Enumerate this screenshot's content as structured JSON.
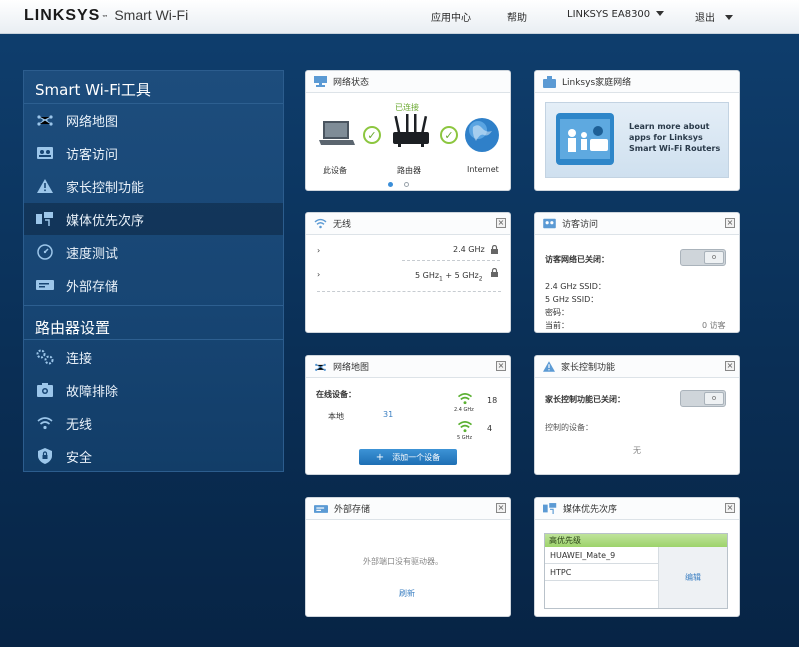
{
  "header": {
    "brand": "LINKSYS",
    "tm": "™",
    "subtitle": "Smart Wi-Fi",
    "nav": [
      "应用中心",
      "帮助",
      "LINKSYS EA8300",
      "退出"
    ]
  },
  "sidebar": {
    "tools_title": "Smart Wi-Fi工具",
    "tools": [
      {
        "label": "网络地图",
        "icon": "network-map-icon"
      },
      {
        "label": "访客访问",
        "icon": "guest-access-icon"
      },
      {
        "label": "家长控制功能",
        "icon": "parental-controls-icon"
      },
      {
        "label": "媒体优先次序",
        "icon": "media-prioritization-icon"
      },
      {
        "label": "速度测试",
        "icon": "speed-test-icon"
      },
      {
        "label": "外部存储",
        "icon": "external-storage-icon"
      }
    ],
    "router_title": "路由器设置",
    "router": [
      {
        "label": "连接",
        "icon": "connectivity-icon"
      },
      {
        "label": "故障排除",
        "icon": "troubleshooting-icon"
      },
      {
        "label": "无线",
        "icon": "wireless-icon"
      },
      {
        "label": "安全",
        "icon": "security-icon"
      }
    ]
  },
  "network_status": {
    "title": "网络状态",
    "connected": "已连接",
    "this_device": "此设备",
    "router": "路由器",
    "internet": "Internet"
  },
  "linksys_home": {
    "title": "Linksys家庭网络",
    "promo": "Learn more about apps for Linksys Smart Wi-Fi Routers"
  },
  "wireless": {
    "title": "无线",
    "band1": "2.4 GHz",
    "band2_a": "5 GHz",
    "band2_sub1": "1",
    "band2_b": " + 5 GHz",
    "band2_sub2": "2"
  },
  "guest": {
    "title": "访客访问",
    "status": "访客网络已关闭：",
    "ssid24": "2.4 GHz SSID：",
    "ssid5": "5 GHz SSID：",
    "password": "密码：",
    "current": "当前：",
    "count": "0 访客"
  },
  "network_map": {
    "title": "网络地图",
    "online_label": "在线设备：",
    "local_label": "本地",
    "local_count": "31",
    "band24_label": "2.4 GHz",
    "band24_count": "18",
    "band5_label": "5 GHz",
    "band5_count": "4",
    "add_button": "添加一个设备"
  },
  "parental": {
    "title": "家长控制功能",
    "status": "家长控制功能已关闭：",
    "controlled": "控制的设备：",
    "none": "无"
  },
  "storage": {
    "title": "外部存储",
    "message": "外部端口没有驱动器。",
    "refresh": "刷新"
  },
  "media": {
    "title": "媒体优先次序",
    "high": "高优先级",
    "devices": [
      "HUAWEI_Mate_9",
      "HTPC"
    ],
    "edit": "编辑"
  },
  "colors": {
    "accent_green": "#8cc63f",
    "link_blue": "#3b7fc2",
    "panel_blue": "#174573"
  }
}
